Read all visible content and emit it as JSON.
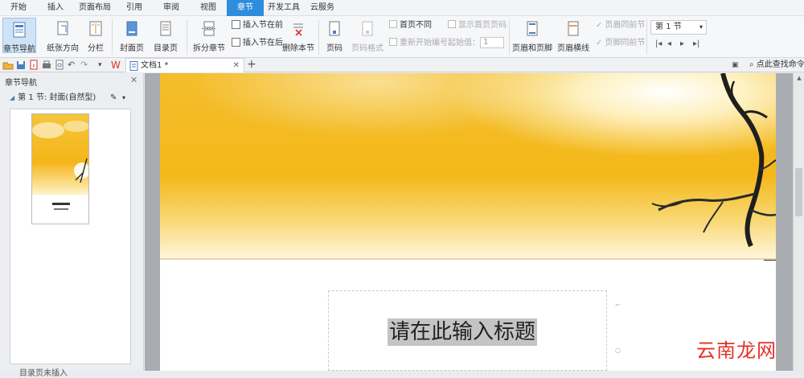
{
  "menu": {
    "tabs": [
      "开始",
      "插入",
      "页面布局",
      "引用",
      "审阅",
      "视图",
      "章节",
      "开发工具",
      "云服务"
    ],
    "active": "章节"
  },
  "ribbon": {
    "section_nav": "章节导航",
    "paper_orientation": "纸张方向",
    "columns": "分栏",
    "cover_page": "封面页",
    "toc_page": "目录页",
    "split_section": "拆分章节",
    "insert_before": "插入节在前",
    "insert_after": "插入节在后",
    "delete_section": "删除本节",
    "page_number": "页码",
    "page_number_format": "页码格式",
    "first_page_diff": "首页不同",
    "renumber": "重新开始编号",
    "show_first_number": "显示首页页码",
    "start_value_label": "起始值：",
    "start_value": "1",
    "header_footer": "页眉和页脚",
    "header_line": "页眉横线",
    "header_same": "页眉同前节",
    "footer_same": "页脚同前节",
    "section_select": "第 1 节"
  },
  "document": {
    "tab_title": "文档1 *",
    "search_label": "点此查找命令"
  },
  "navpane": {
    "title": "章节导航",
    "section_label": "第 1 节: 封面(自然型)",
    "bottom_label": "目录页未插入"
  },
  "page": {
    "title_placeholder": "请在此输入标题"
  },
  "watermark": "云南龙网",
  "colors": {
    "accent": "#2e8ddc",
    "banner_gold": "#f3b81c"
  }
}
